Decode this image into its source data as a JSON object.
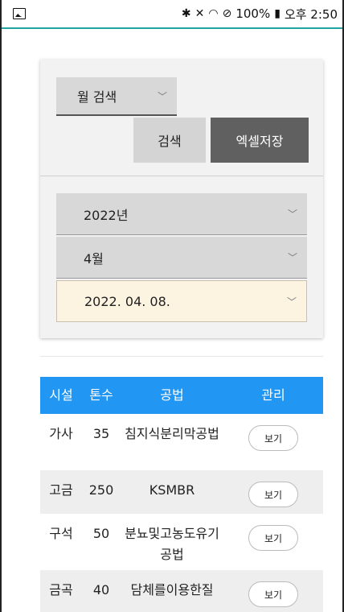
{
  "status_bar": {
    "battery": "100%",
    "time": "오후 2:50",
    "icons": [
      "image-icon",
      "bluetooth-icon",
      "mute-icon",
      "wifi-icon",
      "no-sim-icon",
      "battery-icon"
    ]
  },
  "search": {
    "mode_select": "월 검색",
    "search_label": "검색",
    "excel_label": "엑셀저장",
    "year_select": "2022년",
    "month_select": "4월",
    "date_select": "2022. 04. 08."
  },
  "table": {
    "headers": {
      "facility": "시설",
      "tons": "톤수",
      "method": "공법",
      "manage": "관리"
    },
    "rows": [
      {
        "facility": "가사",
        "tons": "35",
        "method": "침지식분리막공법",
        "action": "보기"
      },
      {
        "facility": "고금",
        "tons": "250",
        "method": "KSMBR",
        "action": "보기"
      },
      {
        "facility": "구석",
        "tons": "50",
        "method": "분뇨및고농도유기공법",
        "action": "보기"
      },
      {
        "facility": "금곡",
        "tons": "40",
        "method": "담체를이용한질",
        "action": "보기"
      }
    ]
  },
  "colors": {
    "accent_blue": "#2196f3",
    "excel_button": "#606060",
    "date_highlight": "#fdf3e1",
    "status_line": "#1fa4a0"
  }
}
